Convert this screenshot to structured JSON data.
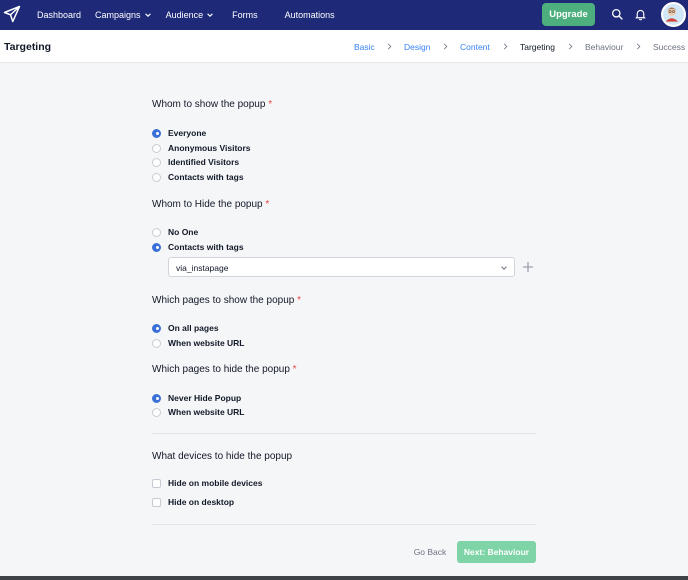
{
  "nav": {
    "items": [
      {
        "label": "Dashboard",
        "dropdown": false
      },
      {
        "label": "Campaigns",
        "dropdown": true
      },
      {
        "label": "Audience",
        "dropdown": true
      },
      {
        "label": "Forms",
        "dropdown": false
      },
      {
        "label": "Automations",
        "dropdown": false
      }
    ],
    "upgrade_label": "Upgrade"
  },
  "header": {
    "title": "Targeting",
    "breadcrumb": [
      {
        "label": "Basic",
        "state": "done"
      },
      {
        "label": "Design",
        "state": "done"
      },
      {
        "label": "Content",
        "state": "done"
      },
      {
        "label": "Targeting",
        "state": "current"
      },
      {
        "label": "Behaviour",
        "state": "future"
      },
      {
        "label": "Success",
        "state": "future"
      }
    ]
  },
  "sections": {
    "show_whom": {
      "title": "Whom to show the popup",
      "required_mark": "*",
      "options": [
        {
          "label": "Everyone",
          "selected": true
        },
        {
          "label": "Anonymous Visitors",
          "selected": false
        },
        {
          "label": "Identified Visitors",
          "selected": false
        },
        {
          "label": "Contacts with tags",
          "selected": false
        }
      ]
    },
    "hide_whom": {
      "title": "Whom to Hide the popup",
      "required_mark": "*",
      "options": [
        {
          "label": "No One",
          "selected": false
        },
        {
          "label": "Contacts with tags",
          "selected": true
        }
      ],
      "tag_select_value": "via_instapage"
    },
    "show_pages": {
      "title": "Which pages to show the popup",
      "required_mark": "*",
      "options": [
        {
          "label": "On all pages",
          "selected": true
        },
        {
          "label": "When website URL",
          "selected": false
        }
      ]
    },
    "hide_pages": {
      "title": "Which pages to hide the popup",
      "required_mark": "*",
      "options": [
        {
          "label": "Never Hide Popup",
          "selected": true
        },
        {
          "label": "When website URL",
          "selected": false
        }
      ]
    },
    "hide_devices": {
      "title": "What devices to hide the popup",
      "options": [
        {
          "label": "Hide on mobile devices",
          "checked": false
        },
        {
          "label": "Hide on desktop",
          "checked": false
        }
      ]
    }
  },
  "footer": {
    "back_label": "Go Back",
    "next_label": "Next: Behaviour"
  },
  "colors": {
    "nav_bg": "#1e2a78",
    "upgrade": "#4caf7d",
    "accent": "#3b6fd8",
    "required": "#ef4444",
    "next_button": "#7ed4a6"
  }
}
